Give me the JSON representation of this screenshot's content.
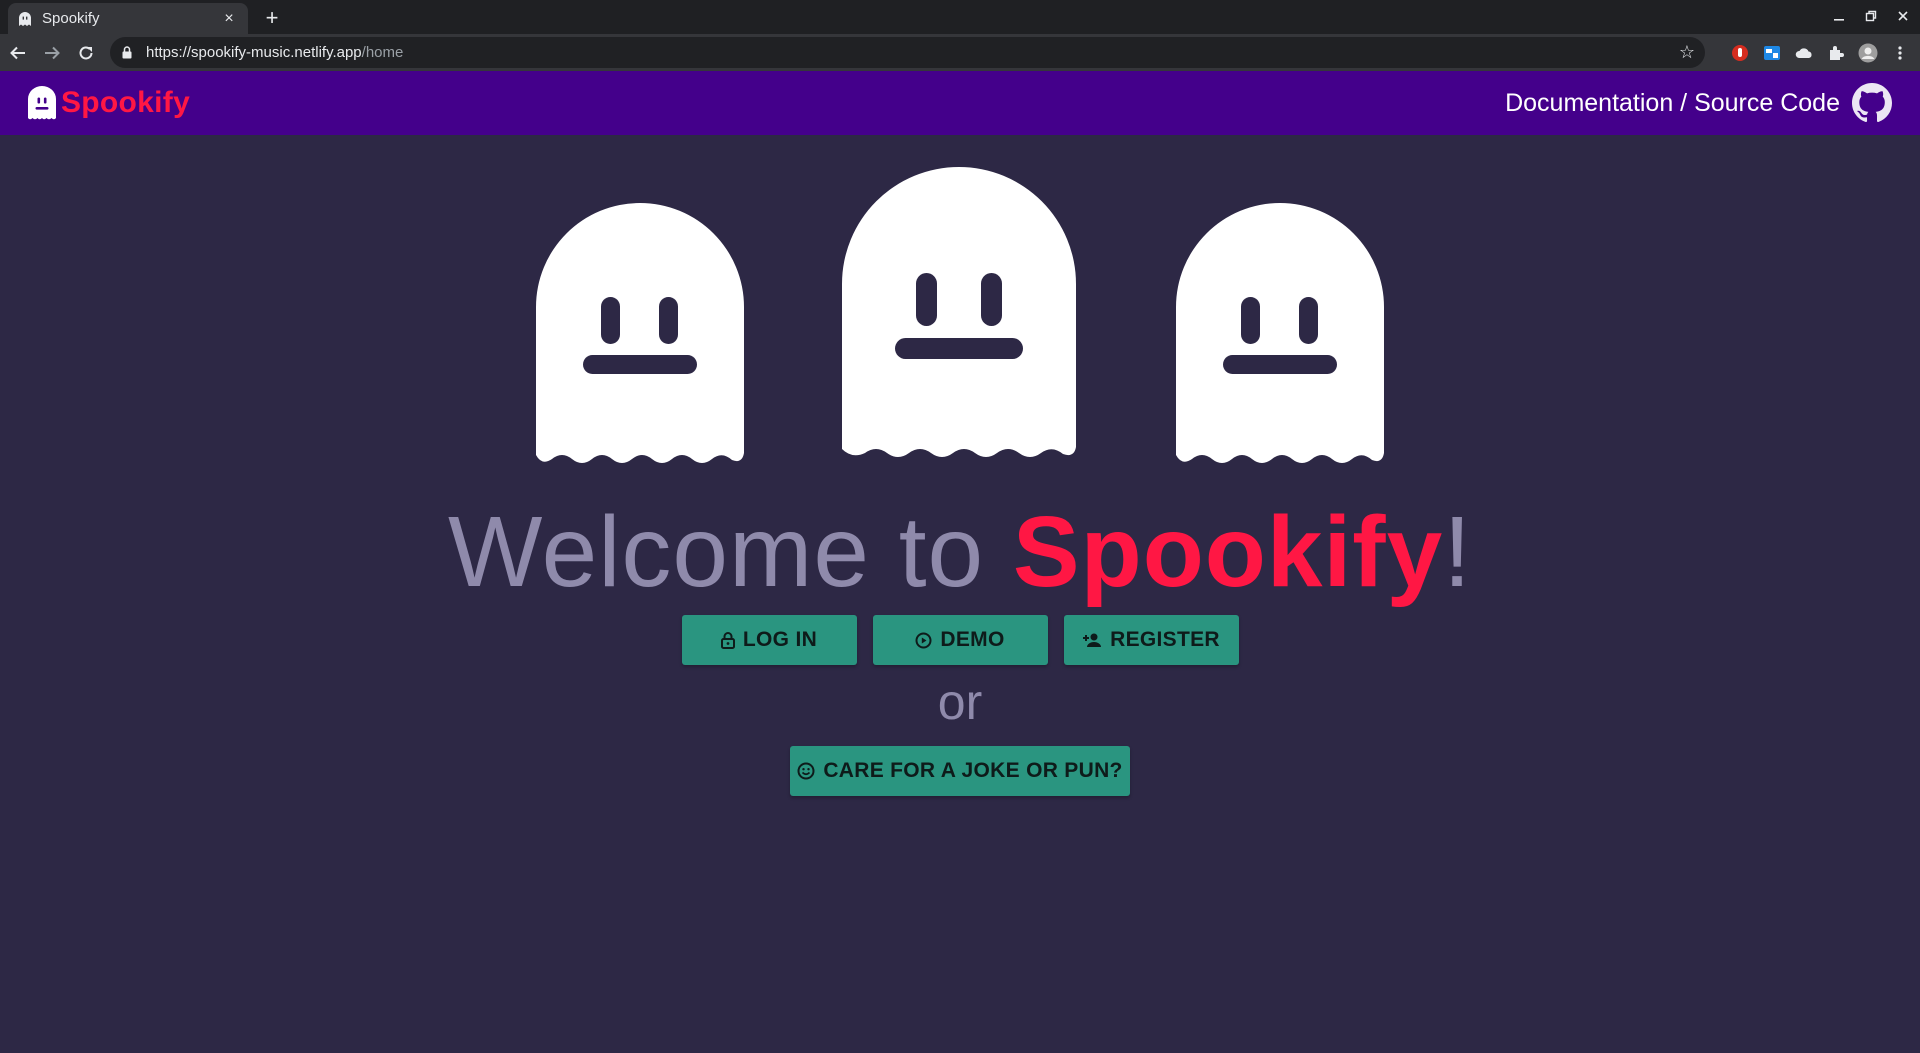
{
  "browser": {
    "tab_title": "Spookify",
    "tab_close": "×",
    "new_tab": "+",
    "url_host": "https://spookify-music.netlify.app",
    "url_path": "/home",
    "icons": [
      "back-icon",
      "forward-icon",
      "reload-icon",
      "lock-icon",
      "star-icon",
      "extensions-icon",
      "profile-icon",
      "menu-icon"
    ]
  },
  "header": {
    "brand_name": "Spookify",
    "doc_link": "Documentation / Source Code",
    "colors": {
      "background": "#44008b",
      "brand": "#ff1744"
    }
  },
  "main": {
    "welcome_prefix": "Welcome to ",
    "welcome_accent": "Spookify",
    "welcome_suffix": "!",
    "or_text": "or",
    "buttons": {
      "login": "LOG IN",
      "demo": "DEMO",
      "register": "REGISTER",
      "joke": "CARE FOR A JOKE OR PUN?"
    },
    "colors": {
      "background": "#2d2845",
      "button": "#2a9580",
      "muted_text": "#8f8aab"
    }
  }
}
